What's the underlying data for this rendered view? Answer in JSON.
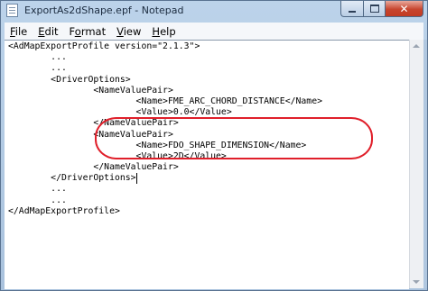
{
  "window": {
    "title": "ExportAs2dShape.epf - Notepad"
  },
  "menu": {
    "file": {
      "hotkey": "F",
      "rest": "ile"
    },
    "edit": {
      "hotkey": "E",
      "rest": "dit"
    },
    "format": {
      "lead": "F",
      "hotkey": "o",
      "rest": "rmat"
    },
    "view": {
      "hotkey": "V",
      "rest": "iew"
    },
    "help": {
      "hotkey": "H",
      "rest": "elp"
    }
  },
  "editor": {
    "lines": [
      "<AdMapExportProfile version=\"2.1.3\">",
      "        ...",
      "        ...",
      "        <DriverOptions>",
      "                <NameValuePair>",
      "                        <Name>FME_ARC_CHORD_DISTANCE</Name>",
      "                        <Value>0.0</Value>",
      "                </NameValuePair>",
      "                <NameValuePair>",
      "                        <Name>FDO_SHAPE_DIMENSION</Name>",
      "                        <Value>2D</Value>",
      "                </NameValuePair>",
      "        </DriverOptions>",
      "        ...",
      "        ...",
      "</AdMapExportProfile>"
    ]
  },
  "annotation": {
    "highlight_color": "#e01f2a"
  }
}
